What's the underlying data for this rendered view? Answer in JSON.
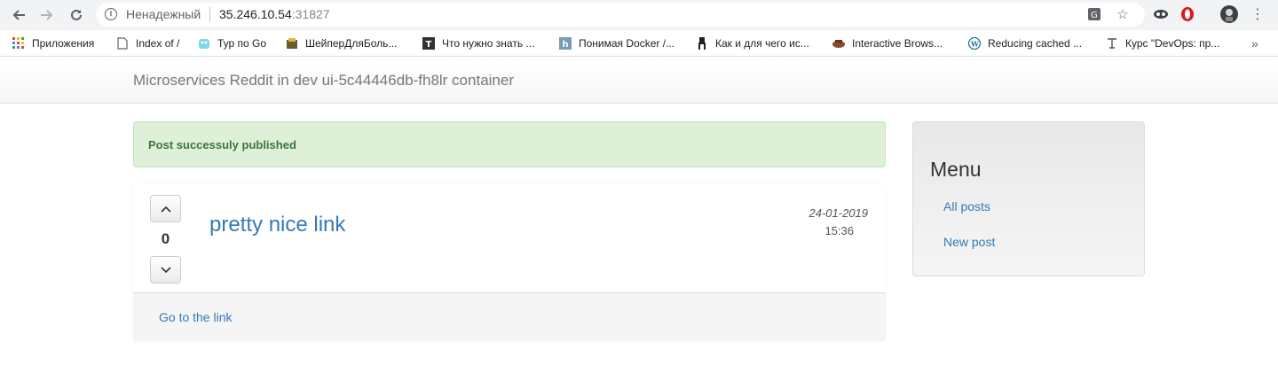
{
  "browser": {
    "security_label": "Ненадежный",
    "url_host": "35.246.10.54",
    "url_port": ":31827",
    "bookmarks": [
      {
        "label": "Приложения",
        "icon": "apps-grid-icon"
      },
      {
        "label": "Index of /",
        "icon": "page-icon"
      },
      {
        "label": "Тур по Go",
        "icon": "gopher-icon"
      },
      {
        "label": "ШейперДляБоль...",
        "icon": "site-icon"
      },
      {
        "label": "Что нужно знать ...",
        "icon": "t-square-icon"
      },
      {
        "label": "Понимая Docker /...",
        "icon": "habr-icon"
      },
      {
        "label": "Как и для чего ис...",
        "icon": "chair-icon"
      },
      {
        "label": "Interactive Brows...",
        "icon": "site-icon"
      },
      {
        "label": "Reducing cached ...",
        "icon": "wordpress-icon"
      },
      {
        "label": "Курс \"DevOps: пр...",
        "icon": "site-icon"
      }
    ],
    "more_bookmarks": "»"
  },
  "navbar": {
    "brand": "Microservices Reddit in dev ui-5c44446db-fh8lr container"
  },
  "alert": {
    "message": "Post successuly published"
  },
  "post": {
    "votes": "0",
    "title": "pretty nice link",
    "date": "24-01-2019",
    "time": "15:36",
    "link_label": "Go to the link"
  },
  "sidebar": {
    "title": "Menu",
    "links": [
      "All posts",
      "New post"
    ]
  },
  "colors": {
    "link": "#337ab7",
    "alert_bg": "#dff0d8",
    "alert_text": "#3c763d"
  }
}
